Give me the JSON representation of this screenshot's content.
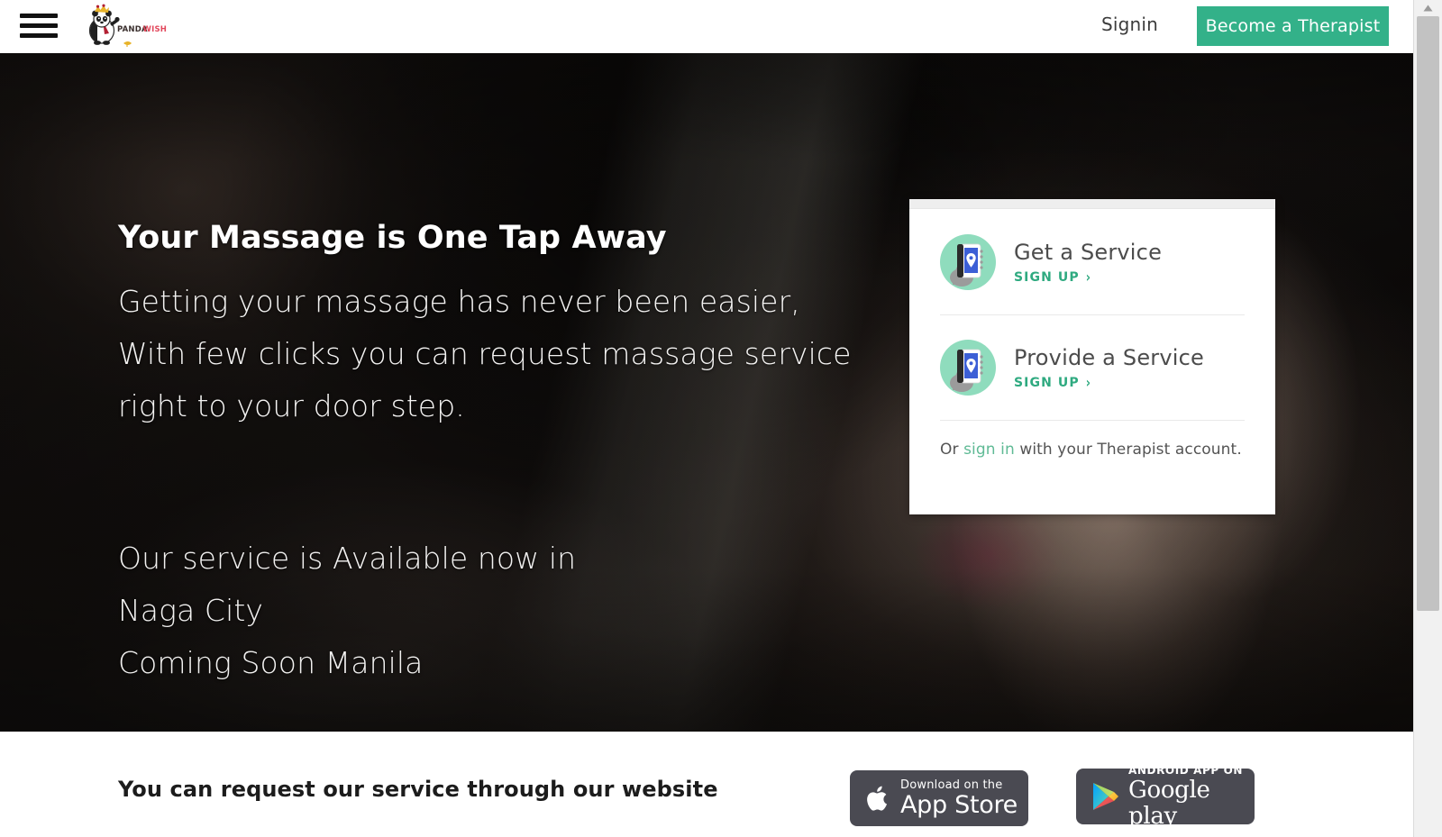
{
  "header": {
    "menu_icon": "hamburger-menu-icon",
    "logo": {
      "brand_part1": "PANDA",
      "brand_part2": "WISH",
      "alt": "pandawish-logo"
    },
    "signin_label": "Signin",
    "become_therapist_label": "Become a Therapist",
    "accent_color": "#33b189"
  },
  "hero": {
    "title": "Your Massage is One Tap Away",
    "lines": [
      "Getting your massage has never been easier,",
      "With few clicks you can request massage service",
      "right to your door step."
    ],
    "availability": [
      "Our service is Available now in",
      "Naga City",
      "Coming Soon Manila"
    ]
  },
  "signup_card": {
    "options": [
      {
        "title": "Get a Service",
        "link_label": "SIGN UP",
        "chevron": "›",
        "icon": "hand-holding-phone-pin-icon"
      },
      {
        "title": "Provide a Service",
        "link_label": "SIGN UP",
        "chevron": "›",
        "icon": "hand-holding-phone-pin-icon"
      }
    ],
    "footer": {
      "prefix": "Or ",
      "link": "sign in",
      "suffix": " with your Therapist account."
    },
    "link_color": "#2faa80"
  },
  "bottom": {
    "text": "You can request our service through our website",
    "badges": [
      {
        "id": "app-store",
        "icon": "apple-logo-icon",
        "small_label": "Download on the",
        "big_label": "App Store"
      },
      {
        "id": "google-play",
        "icon": "google-play-triangle-icon",
        "small_label": "ANDROID APP ON",
        "big_label": "Google play"
      }
    ]
  },
  "scrollbar": {
    "up_arrow": "▲"
  }
}
